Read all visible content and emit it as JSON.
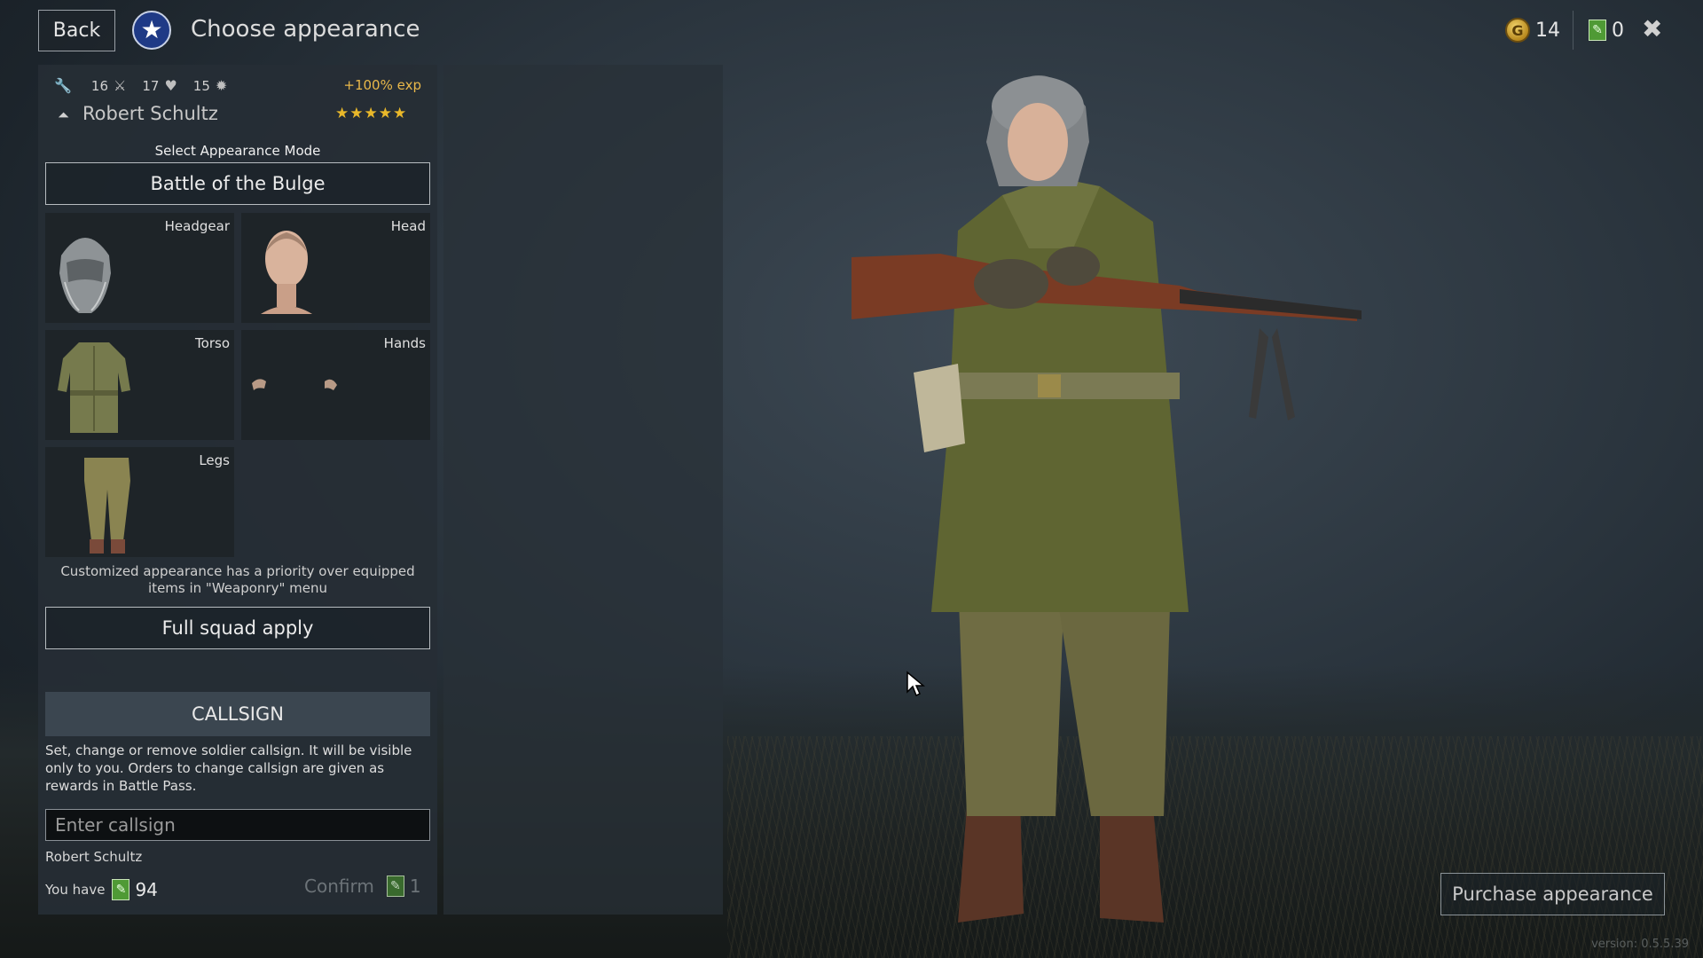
{
  "header": {
    "back_label": "Back",
    "title": "Choose appearance",
    "gold": "14",
    "tickets": "0"
  },
  "soldier": {
    "stats": [
      "16",
      "17",
      "15"
    ],
    "exp_bonus": "+100% exp",
    "name": "Robert Schultz",
    "stars": "★★★★★"
  },
  "appearance": {
    "mode_label": "Select Appearance Mode",
    "mode_value": "Battle of the Bulge",
    "slots": {
      "headgear": "Headgear",
      "head": "Head",
      "torso": "Torso",
      "hands": "Hands",
      "legs": "Legs"
    },
    "note": "Customized appearance has a priority over equipped items in \"Weaponry\" menu",
    "squad_apply": "Full squad apply"
  },
  "callsign": {
    "header": "CALLSIGN",
    "description": "Set, change or remove soldier callsign. It will be visible only to you. Orders to change callsign are given as rewards in Battle Pass.",
    "placeholder": "Enter callsign",
    "current": "Robert Schultz",
    "you_have_label": "You have",
    "you_have_amount": "94",
    "confirm_label": "Confirm",
    "confirm_cost": "1"
  },
  "purchase_label": "Purchase appearance",
  "version": "version: 0.5.5.39",
  "colors": {
    "accent_gold": "#e9b84a",
    "ticket_green": "#4f9a35",
    "panel_bg": "#262e35"
  },
  "icons": [
    "wrench-icon",
    "bayonet-icon",
    "heart-icon",
    "grenade-icon",
    "rank-icon",
    "star-icon",
    "coin-icon",
    "ticket-icon",
    "close-icon",
    "cursor-icon"
  ]
}
